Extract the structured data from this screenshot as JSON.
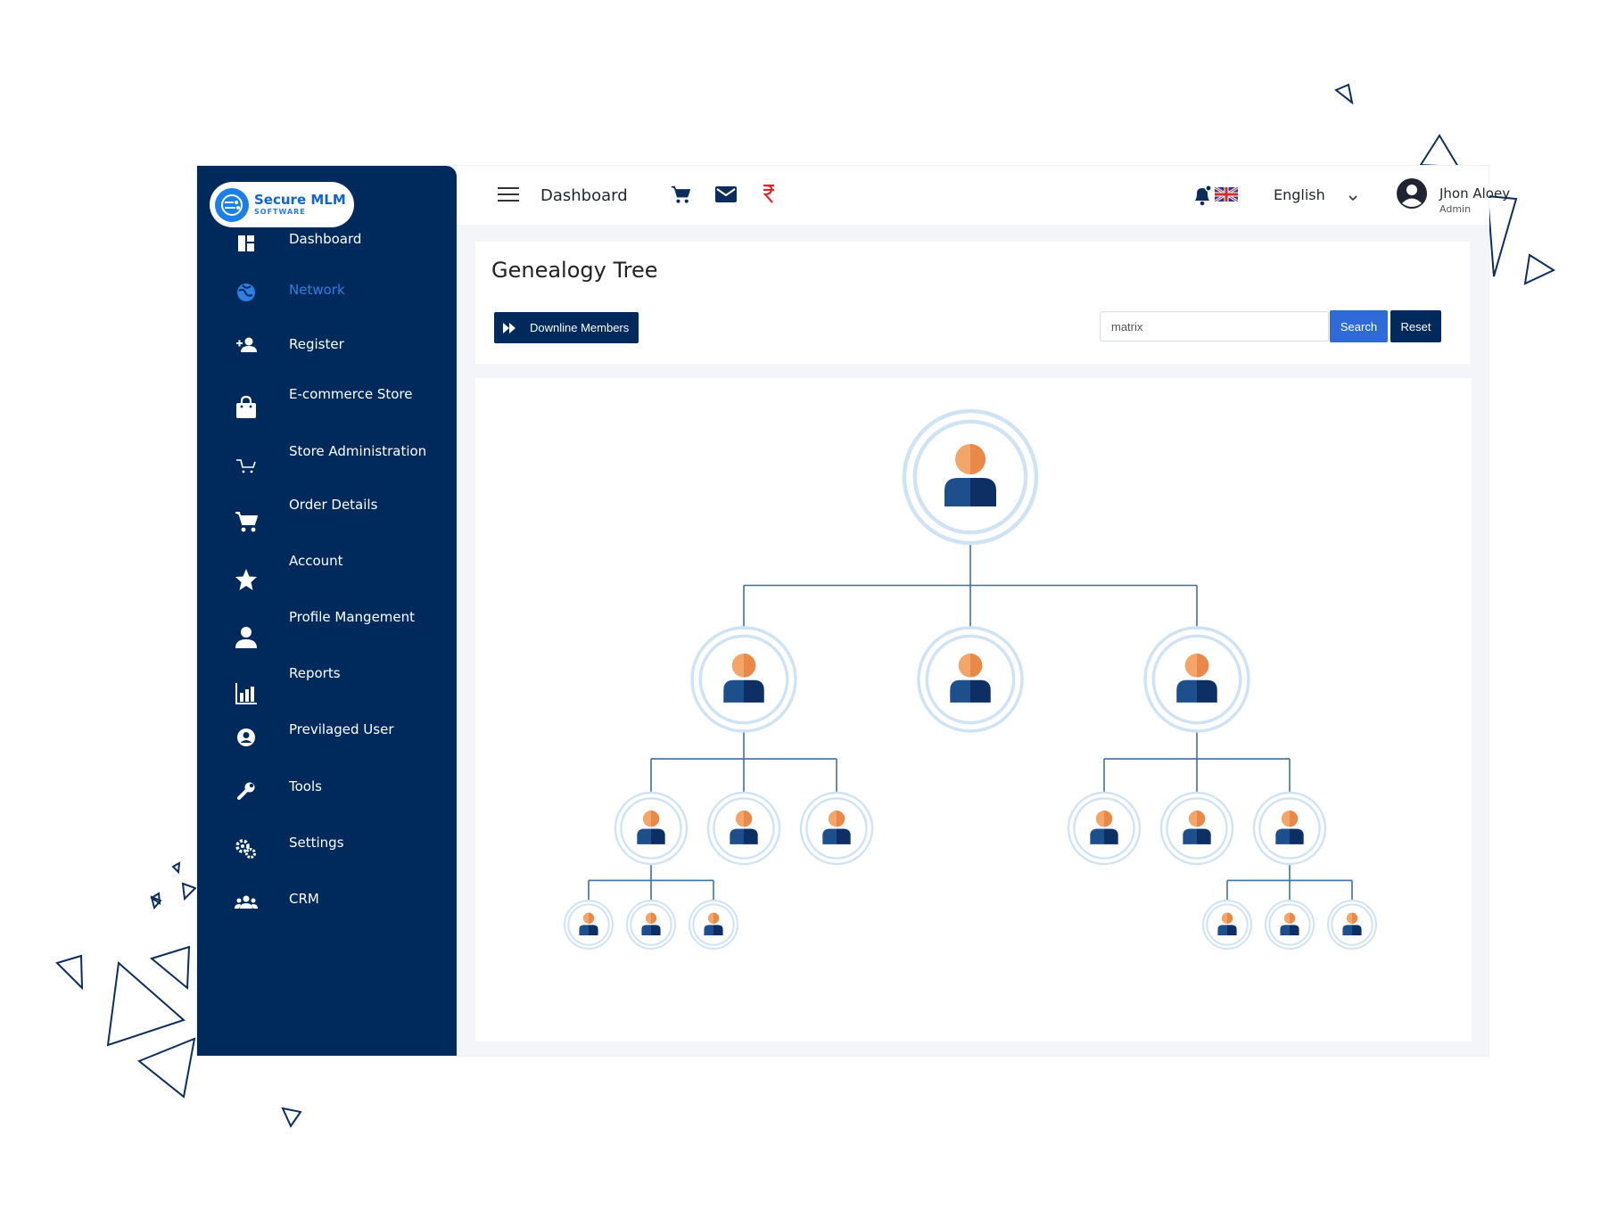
{
  "brand": {
    "name": "Secure MLM",
    "tagline": "SOFTWARE"
  },
  "sidebar": {
    "items": [
      {
        "label": "Dashboard",
        "icon": "dashboard-icon"
      },
      {
        "label": "Network",
        "icon": "network-globe-icon",
        "active": true
      },
      {
        "label": "Register",
        "icon": "add-user-icon"
      },
      {
        "label": "E-commerce Store",
        "icon": "shopping-bag-icon"
      },
      {
        "label": "Store Administration",
        "icon": "store-cart-icon"
      },
      {
        "label": "Order Details",
        "icon": "cart-icon"
      },
      {
        "label": "Account",
        "icon": "star-icon"
      },
      {
        "label": "Profile Mangement",
        "icon": "person-icon"
      },
      {
        "label": "Reports",
        "icon": "bar-chart-icon"
      },
      {
        "label": "Previlaged User",
        "icon": "account-circle-icon"
      },
      {
        "label": "Tools",
        "icon": "wrench-icon"
      },
      {
        "label": "Settings",
        "icon": "gears-icon"
      },
      {
        "label": "CRM",
        "icon": "group-icon"
      }
    ]
  },
  "header": {
    "title": "Dashboard",
    "icons": [
      "menu-icon",
      "cart-icon",
      "mail-icon",
      "rupee-icon",
      "bell-icon",
      "uk-flag-icon"
    ],
    "language": "English",
    "user": {
      "name": "Jhon Aloey",
      "role": "Admin"
    }
  },
  "page": {
    "title": "Genealogy Tree",
    "downline_button": "Downline Members",
    "search": {
      "value": "matrix",
      "button": "Search",
      "reset": "Reset"
    }
  },
  "colors": {
    "sidebar": "#002a5c",
    "active": "#2f7ee0",
    "search_button": "#2f6bd8",
    "reset_button": "#002a5c",
    "tree_line": "#3e6f9e",
    "node_ring": "#cfe3f5",
    "avatar_head": "#f4a66a",
    "avatar_body": "#1d4f8c"
  },
  "tree": {
    "node": "root",
    "children": [
      {
        "node": "member",
        "children": [
          {
            "node": "member",
            "children": [
              {
                "node": "member"
              },
              {
                "node": "member"
              },
              {
                "node": "member"
              }
            ]
          },
          {
            "node": "member"
          },
          {
            "node": "member"
          }
        ]
      },
      {
        "node": "member"
      },
      {
        "node": "member",
        "children": [
          {
            "node": "member"
          },
          {
            "node": "member"
          },
          {
            "node": "member",
            "children": [
              {
                "node": "member"
              },
              {
                "node": "member"
              },
              {
                "node": "member"
              }
            ]
          }
        ]
      }
    ]
  }
}
